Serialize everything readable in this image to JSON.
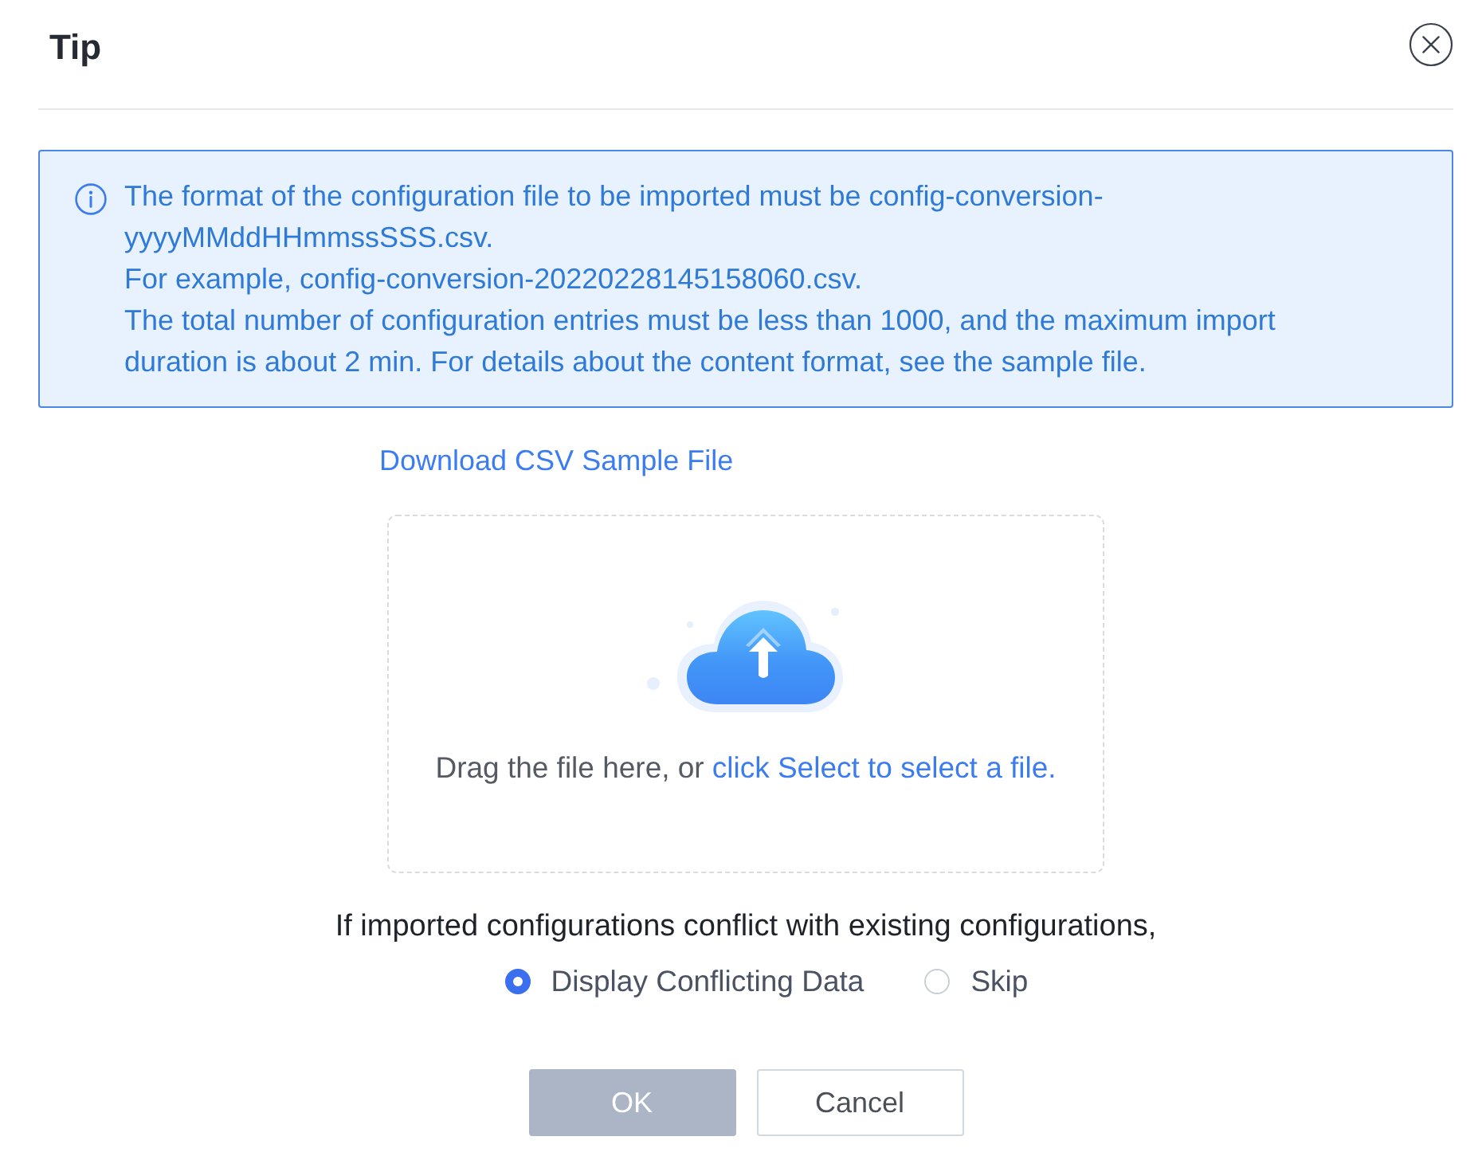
{
  "dialog": {
    "title": "Tip"
  },
  "notice": {
    "lines": [
      "The format of the configuration file to be imported must be config-conversion-yyyyMMddHHmmssSSS.csv.",
      "For example, config-conversion-20220228145158060.csv.",
      "The total number of configuration entries must be less than 1000, and the maximum import duration is about 2 min. For details about the content format, see the sample file."
    ]
  },
  "sample_link": "Download CSV Sample File",
  "drop_zone": {
    "hint": "Drag the file here, or",
    "link": "click Select to select a file."
  },
  "conflict": {
    "question": "If imported configurations conflict with existing configurations,",
    "options": [
      {
        "label": "Display Conflicting Data",
        "selected": true
      },
      {
        "label": "Skip",
        "selected": false
      }
    ]
  },
  "buttons": [
    {
      "label": "OK",
      "kind": "primary",
      "disabled": true
    },
    {
      "label": "Cancel",
      "kind": "default",
      "disabled": false
    }
  ]
}
